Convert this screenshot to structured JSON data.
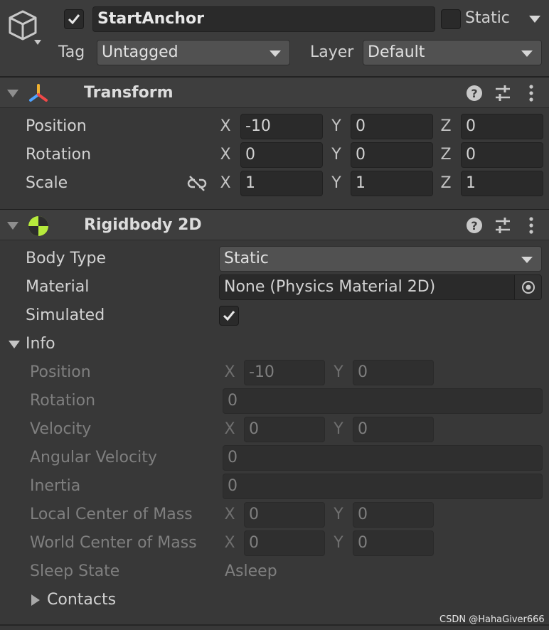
{
  "object": {
    "name": "StartAnchor",
    "active_checked": true,
    "static_label": "Static",
    "static_checked": false,
    "tag_label": "Tag",
    "tag_value": "Untagged",
    "layer_label": "Layer",
    "layer_value": "Default"
  },
  "transform": {
    "title": "Transform",
    "position": {
      "label": "Position",
      "x": "-10",
      "y": "0",
      "z": "0"
    },
    "rotation": {
      "label": "Rotation",
      "x": "0",
      "y": "0",
      "z": "0"
    },
    "scale": {
      "label": "Scale",
      "x": "1",
      "y": "1",
      "z": "1"
    },
    "axes": {
      "x": "X",
      "y": "Y",
      "z": "Z"
    }
  },
  "rigidbody": {
    "title": "Rigidbody 2D",
    "body_type_label": "Body Type",
    "body_type_value": "Static",
    "material_label": "Material",
    "material_value": "None (Physics Material 2D)",
    "simulated_label": "Simulated",
    "simulated_checked": true,
    "info": {
      "label": "Info",
      "position": {
        "label": "Position",
        "x": "-10",
        "y": "0"
      },
      "rotation": {
        "label": "Rotation",
        "value": "0"
      },
      "velocity": {
        "label": "Velocity",
        "x": "0",
        "y": "0"
      },
      "angular_velocity": {
        "label": "Angular Velocity",
        "value": "0"
      },
      "inertia": {
        "label": "Inertia",
        "value": "0"
      },
      "local_center": {
        "label": "Local Center of Mass",
        "x": "0",
        "y": "0"
      },
      "world_center": {
        "label": "World Center of Mass",
        "x": "0",
        "y": "0"
      },
      "sleep_state": {
        "label": "Sleep State",
        "value": "Asleep"
      },
      "contacts_label": "Contacts"
    }
  },
  "watermark": "CSDN @HahaGiver666",
  "icons": {
    "gameobject": "cube-icon",
    "transform": "transform-axes-icon",
    "rigidbody": "rigidbody2d-icon",
    "help": "help-icon",
    "presets": "presets-icon",
    "menu": "kebab-menu-icon",
    "unlink": "unlink-icon",
    "object_picker": "object-picker-icon"
  },
  "colors": {
    "background": "#383838",
    "field": "#2a2a2a",
    "header": "#3e3e3e",
    "rigidbody_icon": "#b6ea3c"
  }
}
